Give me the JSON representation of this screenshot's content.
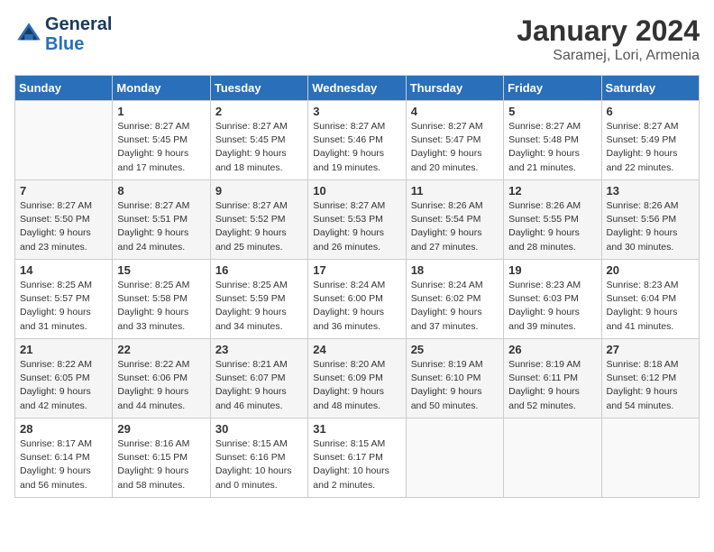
{
  "header": {
    "logo_line1": "General",
    "logo_line2": "Blue",
    "month": "January 2024",
    "location": "Saramej, Lori, Armenia"
  },
  "days_of_week": [
    "Sunday",
    "Monday",
    "Tuesday",
    "Wednesday",
    "Thursday",
    "Friday",
    "Saturday"
  ],
  "weeks": [
    [
      {
        "day": "",
        "sunrise": "",
        "sunset": "",
        "daylight": ""
      },
      {
        "day": "1",
        "sunrise": "Sunrise: 8:27 AM",
        "sunset": "Sunset: 5:45 PM",
        "daylight": "Daylight: 9 hours and 17 minutes."
      },
      {
        "day": "2",
        "sunrise": "Sunrise: 8:27 AM",
        "sunset": "Sunset: 5:45 PM",
        "daylight": "Daylight: 9 hours and 18 minutes."
      },
      {
        "day": "3",
        "sunrise": "Sunrise: 8:27 AM",
        "sunset": "Sunset: 5:46 PM",
        "daylight": "Daylight: 9 hours and 19 minutes."
      },
      {
        "day": "4",
        "sunrise": "Sunrise: 8:27 AM",
        "sunset": "Sunset: 5:47 PM",
        "daylight": "Daylight: 9 hours and 20 minutes."
      },
      {
        "day": "5",
        "sunrise": "Sunrise: 8:27 AM",
        "sunset": "Sunset: 5:48 PM",
        "daylight": "Daylight: 9 hours and 21 minutes."
      },
      {
        "day": "6",
        "sunrise": "Sunrise: 8:27 AM",
        "sunset": "Sunset: 5:49 PM",
        "daylight": "Daylight: 9 hours and 22 minutes."
      }
    ],
    [
      {
        "day": "7",
        "sunrise": "Sunrise: 8:27 AM",
        "sunset": "Sunset: 5:50 PM",
        "daylight": "Daylight: 9 hours and 23 minutes."
      },
      {
        "day": "8",
        "sunrise": "Sunrise: 8:27 AM",
        "sunset": "Sunset: 5:51 PM",
        "daylight": "Daylight: 9 hours and 24 minutes."
      },
      {
        "day": "9",
        "sunrise": "Sunrise: 8:27 AM",
        "sunset": "Sunset: 5:52 PM",
        "daylight": "Daylight: 9 hours and 25 minutes."
      },
      {
        "day": "10",
        "sunrise": "Sunrise: 8:27 AM",
        "sunset": "Sunset: 5:53 PM",
        "daylight": "Daylight: 9 hours and 26 minutes."
      },
      {
        "day": "11",
        "sunrise": "Sunrise: 8:26 AM",
        "sunset": "Sunset: 5:54 PM",
        "daylight": "Daylight: 9 hours and 27 minutes."
      },
      {
        "day": "12",
        "sunrise": "Sunrise: 8:26 AM",
        "sunset": "Sunset: 5:55 PM",
        "daylight": "Daylight: 9 hours and 28 minutes."
      },
      {
        "day": "13",
        "sunrise": "Sunrise: 8:26 AM",
        "sunset": "Sunset: 5:56 PM",
        "daylight": "Daylight: 9 hours and 30 minutes."
      }
    ],
    [
      {
        "day": "14",
        "sunrise": "Sunrise: 8:25 AM",
        "sunset": "Sunset: 5:57 PM",
        "daylight": "Daylight: 9 hours and 31 minutes."
      },
      {
        "day": "15",
        "sunrise": "Sunrise: 8:25 AM",
        "sunset": "Sunset: 5:58 PM",
        "daylight": "Daylight: 9 hours and 33 minutes."
      },
      {
        "day": "16",
        "sunrise": "Sunrise: 8:25 AM",
        "sunset": "Sunset: 5:59 PM",
        "daylight": "Daylight: 9 hours and 34 minutes."
      },
      {
        "day": "17",
        "sunrise": "Sunrise: 8:24 AM",
        "sunset": "Sunset: 6:00 PM",
        "daylight": "Daylight: 9 hours and 36 minutes."
      },
      {
        "day": "18",
        "sunrise": "Sunrise: 8:24 AM",
        "sunset": "Sunset: 6:02 PM",
        "daylight": "Daylight: 9 hours and 37 minutes."
      },
      {
        "day": "19",
        "sunrise": "Sunrise: 8:23 AM",
        "sunset": "Sunset: 6:03 PM",
        "daylight": "Daylight: 9 hours and 39 minutes."
      },
      {
        "day": "20",
        "sunrise": "Sunrise: 8:23 AM",
        "sunset": "Sunset: 6:04 PM",
        "daylight": "Daylight: 9 hours and 41 minutes."
      }
    ],
    [
      {
        "day": "21",
        "sunrise": "Sunrise: 8:22 AM",
        "sunset": "Sunset: 6:05 PM",
        "daylight": "Daylight: 9 hours and 42 minutes."
      },
      {
        "day": "22",
        "sunrise": "Sunrise: 8:22 AM",
        "sunset": "Sunset: 6:06 PM",
        "daylight": "Daylight: 9 hours and 44 minutes."
      },
      {
        "day": "23",
        "sunrise": "Sunrise: 8:21 AM",
        "sunset": "Sunset: 6:07 PM",
        "daylight": "Daylight: 9 hours and 46 minutes."
      },
      {
        "day": "24",
        "sunrise": "Sunrise: 8:20 AM",
        "sunset": "Sunset: 6:09 PM",
        "daylight": "Daylight: 9 hours and 48 minutes."
      },
      {
        "day": "25",
        "sunrise": "Sunrise: 8:19 AM",
        "sunset": "Sunset: 6:10 PM",
        "daylight": "Daylight: 9 hours and 50 minutes."
      },
      {
        "day": "26",
        "sunrise": "Sunrise: 8:19 AM",
        "sunset": "Sunset: 6:11 PM",
        "daylight": "Daylight: 9 hours and 52 minutes."
      },
      {
        "day": "27",
        "sunrise": "Sunrise: 8:18 AM",
        "sunset": "Sunset: 6:12 PM",
        "daylight": "Daylight: 9 hours and 54 minutes."
      }
    ],
    [
      {
        "day": "28",
        "sunrise": "Sunrise: 8:17 AM",
        "sunset": "Sunset: 6:14 PM",
        "daylight": "Daylight: 9 hours and 56 minutes."
      },
      {
        "day": "29",
        "sunrise": "Sunrise: 8:16 AM",
        "sunset": "Sunset: 6:15 PM",
        "daylight": "Daylight: 9 hours and 58 minutes."
      },
      {
        "day": "30",
        "sunrise": "Sunrise: 8:15 AM",
        "sunset": "Sunset: 6:16 PM",
        "daylight": "Daylight: 10 hours and 0 minutes."
      },
      {
        "day": "31",
        "sunrise": "Sunrise: 8:15 AM",
        "sunset": "Sunset: 6:17 PM",
        "daylight": "Daylight: 10 hours and 2 minutes."
      },
      {
        "day": "",
        "sunrise": "",
        "sunset": "",
        "daylight": ""
      },
      {
        "day": "",
        "sunrise": "",
        "sunset": "",
        "daylight": ""
      },
      {
        "day": "",
        "sunrise": "",
        "sunset": "",
        "daylight": ""
      }
    ]
  ]
}
